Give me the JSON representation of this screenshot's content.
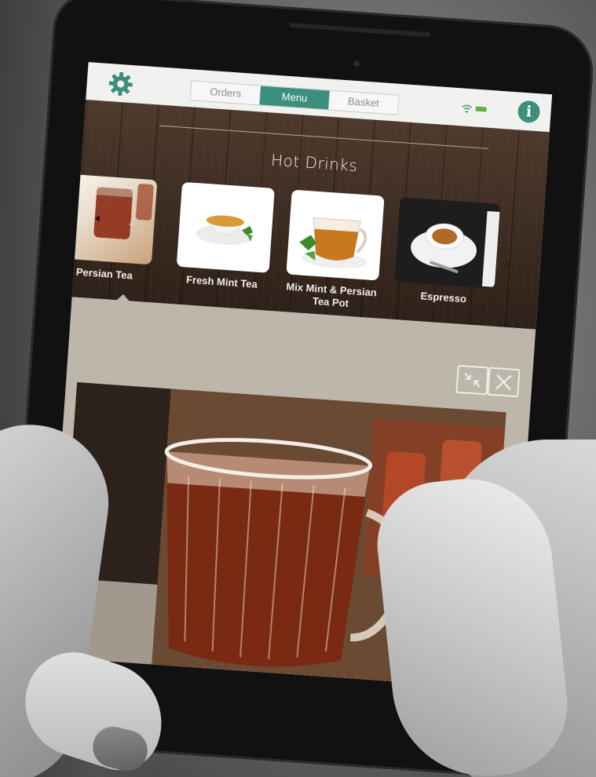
{
  "topbar": {
    "tabs": [
      {
        "label": "Orders",
        "active": false
      },
      {
        "label": "Menu",
        "active": true
      },
      {
        "label": "Basket",
        "active": false
      }
    ],
    "settings_icon": "gear-icon",
    "info_icon": "info-icon",
    "info_glyph": "i",
    "accent_color": "#3c8e7d"
  },
  "menu": {
    "section_title": "Hot Drinks",
    "items": [
      {
        "label": "Persian Tea"
      },
      {
        "label": "Fresh Mint Tea"
      },
      {
        "label": "Mix Mint & Persian Tea Pot"
      },
      {
        "label": "Espresso"
      }
    ]
  },
  "detail": {
    "shrink_icon": "shrink-icon",
    "close_icon": "close-icon"
  }
}
